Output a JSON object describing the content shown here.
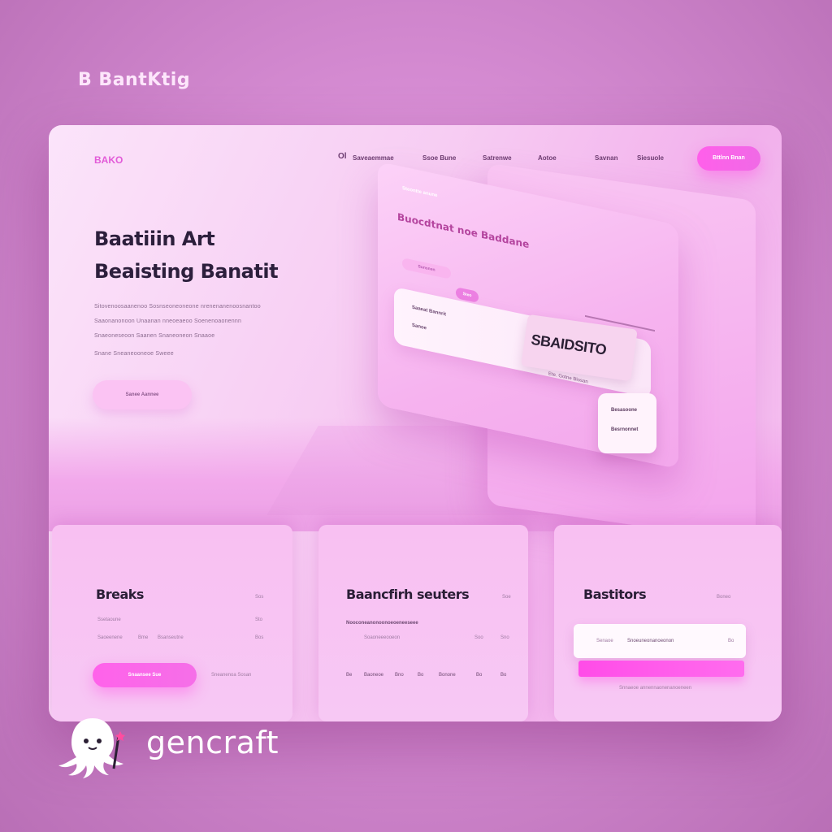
{
  "brand": {
    "top_title": "B BantKtig",
    "logo": "BAKO"
  },
  "nav": {
    "items": [
      "Ol",
      "Saveaemmae",
      "Ssoe Bune",
      "Satrenwe",
      "Aotoe",
      "Savnan",
      "Siesuole"
    ],
    "cta_label": "Bttlnn Bnan"
  },
  "hero": {
    "title_line1": "Baatiiin Art",
    "title_line2": "Beaisting Banatit",
    "body_lines": [
      "Sitovenoosaanenoo Sosnseoneoneone nrenenanenoosnantoo",
      "Saaonanonoon Unaanan nneoeaeoo Soenenoaonennn",
      "Snaeoneseoon Saanen Snaneoneon Snaaoe",
      "Snane Sneaneooneoe Sweee"
    ],
    "button_label": "Sanee Aannee"
  },
  "illustration": {
    "small_label": "Steontte anune",
    "title": "Buocdtnat noe Baddane",
    "chip1": "Sunsnen",
    "chip2": "Steo",
    "card_line1": "Saaeat Bannrit",
    "card_line2": "Sanoe",
    "card_tail": "Ete. Gotne Blosan",
    "sticker": "SBAIDSITO",
    "mini_line1": "Besasoone",
    "mini_line2": "Besrnonnet"
  },
  "cards": [
    {
      "title": "Breaks",
      "tag": "Sos",
      "line1": "Ssetaoune",
      "line1_right": "Sto",
      "line2": "Saoeenene",
      "line2_mid": "Bme",
      "line2_mid2": "Bsanseutne",
      "line2_right": "Bos",
      "button_label": "Snaansee Sue",
      "side_note": "Sneanenoa Sosan"
    },
    {
      "title": "Baancfirh seuters",
      "tag": "Soe",
      "line1": "Nooconeanonoonoeoeneeseee",
      "line2": "Soaoneeeooeon",
      "line2_right": "Soo",
      "line2_right2": "Sno",
      "stats": [
        "Be",
        "Baoneoe",
        "Bno",
        "Bo",
        "Bonone",
        "Bo",
        "Bo"
      ]
    },
    {
      "title": "Bastitors",
      "tag": "Boneo",
      "input_left": "Senaoe",
      "input_mid": "Snoeuneonanoeonon",
      "input_right": "Bo",
      "footnote": "Snnaeoe annennaonenanoeneen"
    }
  ],
  "watermark": {
    "text": "gencraft"
  }
}
